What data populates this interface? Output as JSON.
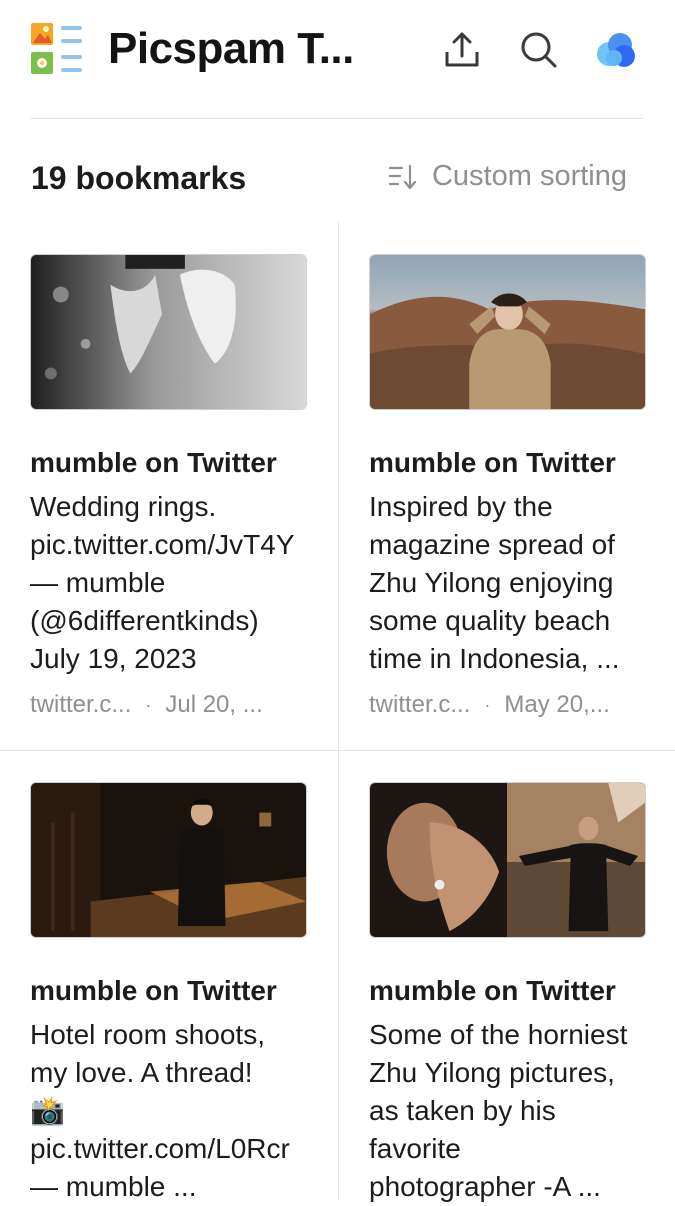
{
  "header": {
    "title": "Picspam T...",
    "app_icon": "list-app-icon",
    "share_icon": "share-icon",
    "search_icon": "search-icon",
    "cloud_icon": "cloud-icon"
  },
  "toolbar": {
    "count_label": "19 bookmarks",
    "sort_label": "Custom sorting",
    "sort_icon": "sort-icon"
  },
  "colors": {
    "cloud_blue": "#2f6bf2",
    "cloud_light": "#6ec6f5",
    "meta_gray": "#8e8e93"
  },
  "cards": [
    {
      "title": "mumble on Twitter",
      "description": "Wedding rings.\npic.twitter.com/JvT4Y\n— mumble\n(@6differentkinds)\nJuly 19, 2023",
      "source": "twitter.c...",
      "date": "Jul 20, ...",
      "image": "black-and-white-hands-with-rings"
    },
    {
      "title": "mumble on Twitter",
      "description": "Inspired by the\nmagazine spread of\nZhu Yilong enjoying\nsome quality beach\ntime in Indonesia, ...",
      "source": "twitter.c...",
      "date": "May 20,...",
      "image": "man-in-desert-landscape"
    },
    {
      "title": "mumble on Twitter",
      "description": "Hotel room shoots,\nmy love. A thread!\n📸\npic.twitter.com/L0Rcr\n— mumble ...",
      "source": "",
      "date": "",
      "image": "man-in-dark-hotel-room"
    },
    {
      "title": "mumble on Twitter",
      "description": "Some of the horniest\nZhu Yilong pictures,\nas taken by his\nfavorite\nphotographer -A ...",
      "source": "",
      "date": "",
      "image": "man-portrait-collage"
    }
  ]
}
